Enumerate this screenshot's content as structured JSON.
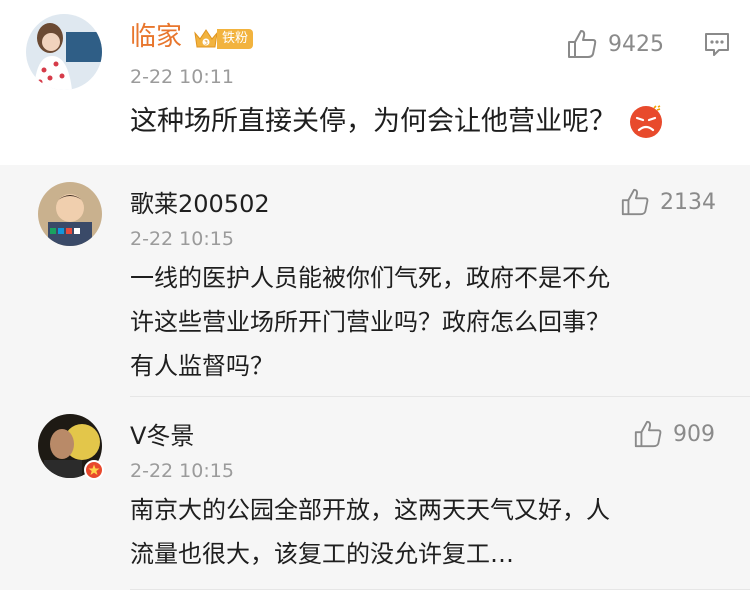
{
  "main_comment": {
    "username": "临家",
    "fan_badge": "铁粉",
    "time": "2-22 10:11",
    "like_count": "9425",
    "text": "这种场所直接关停，为何会让他营业呢？",
    "emoji": "angry-face-icon"
  },
  "replies": [
    {
      "username": "歌莱200502",
      "time": "2-22 10:15",
      "like_count": "2134",
      "text_lines": [
        "一线的医护人员能被你们气死，政府不是不允",
        "许这些营业场所开门营业吗？政府怎么回事？",
        "有人监督吗？"
      ]
    },
    {
      "username": "V冬景",
      "time": "2-22 10:15",
      "like_count": "909",
      "text_lines": [
        "南京大的公园全部开放，这两天天气又好，人",
        "流量也很大，该复工的没允许复工…"
      ]
    }
  ],
  "colors": {
    "main_username": "#e8762d",
    "reply_bg": "#f6f6f6",
    "badge": "#f2b33e"
  }
}
